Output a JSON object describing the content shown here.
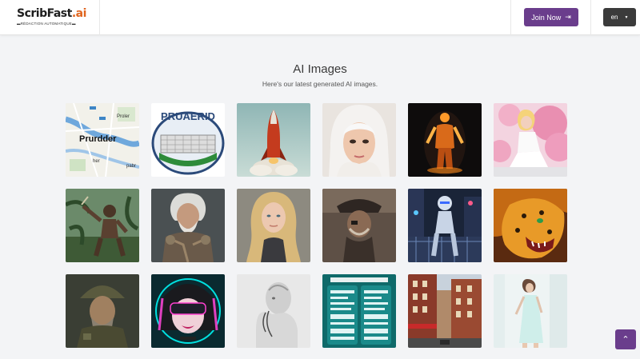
{
  "brand": {
    "name_main": "ScribFast",
    "name_suffix": ".ai",
    "tagline": "▬RÉDACTION AUTOMATIQUE▬"
  },
  "header": {
    "join_label": "Join Now",
    "lang_label": "en"
  },
  "section": {
    "title": "AI Images",
    "subtitle": "Here's our latest generated AI images."
  },
  "images": [
    {
      "subject": "map"
    },
    {
      "subject": "stadium-logo"
    },
    {
      "subject": "rocket"
    },
    {
      "subject": "portrait-white-hair"
    },
    {
      "subject": "fire-figure"
    },
    {
      "subject": "pink-blossom-woman"
    },
    {
      "subject": "jungle-warrior"
    },
    {
      "subject": "old-warrior"
    },
    {
      "subject": "blonde-woman"
    },
    {
      "subject": "pirate"
    },
    {
      "subject": "robot-city"
    },
    {
      "subject": "tiger"
    },
    {
      "subject": "old-man-helmet"
    },
    {
      "subject": "neon-girl-vr"
    },
    {
      "subject": "silver-android"
    },
    {
      "subject": "app-ui"
    },
    {
      "subject": "street-buildings"
    },
    {
      "subject": "woman-white-dress"
    }
  ],
  "map_labels": {
    "city": "Prurdder",
    "a": "Proler",
    "b": "pabr",
    "c": "her"
  },
  "stadium_text": "PRUAERID"
}
